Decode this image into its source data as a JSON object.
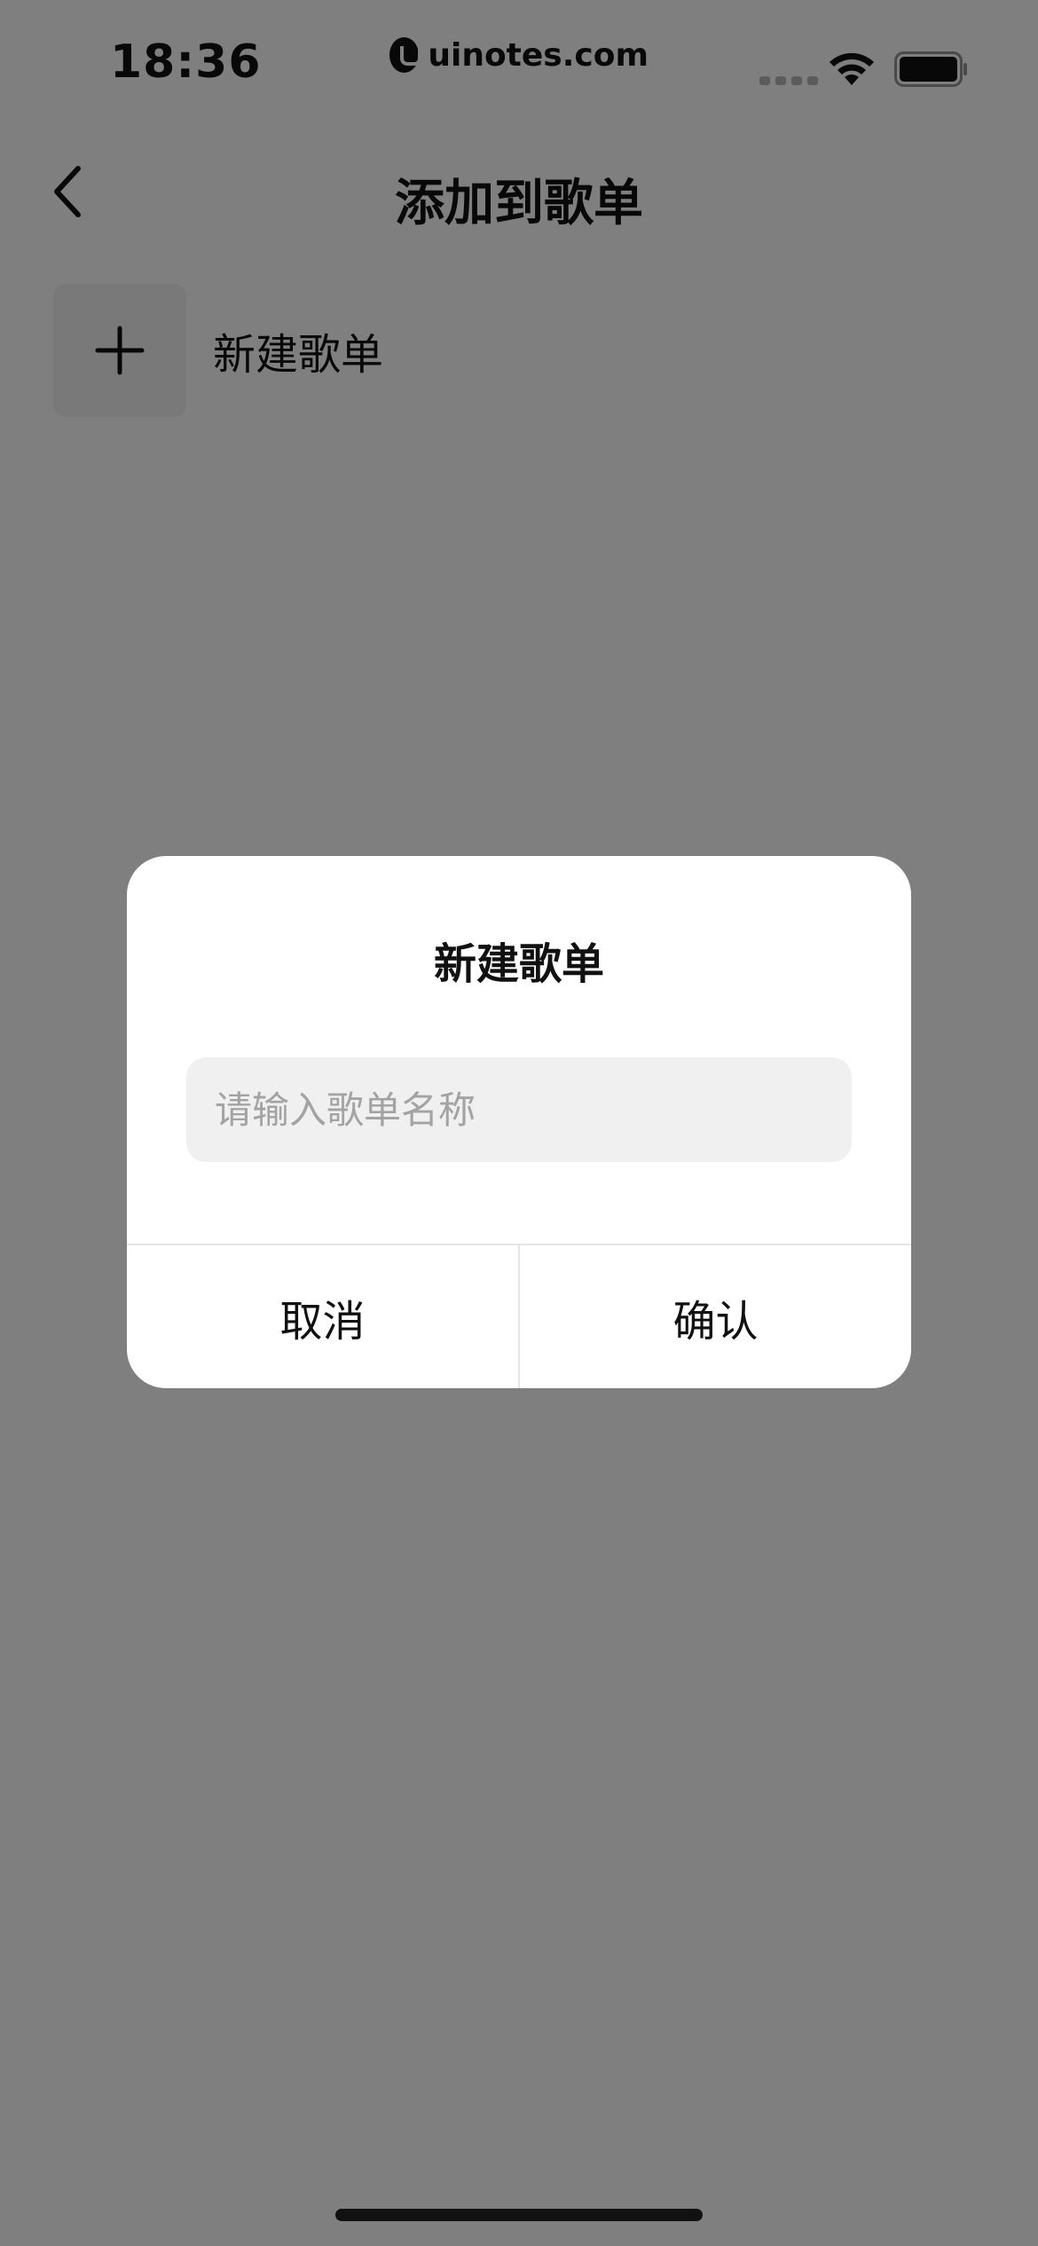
{
  "status_bar": {
    "time": "18:36",
    "watermark": "uinotes.com"
  },
  "nav": {
    "title": "添加到歌单",
    "back_icon": "chevron-left-icon"
  },
  "create_playlist": {
    "label": "新建歌单",
    "icon": "plus-icon"
  },
  "dialog": {
    "title": "新建歌单",
    "input_placeholder": "请输入歌单名称",
    "input_value": "",
    "cancel_label": "取消",
    "confirm_label": "确认"
  },
  "colors": {
    "overlay": "#000000",
    "dialog_bg": "#ffffff",
    "input_bg": "#f0f0f0",
    "placeholder": "#a3a3a3",
    "text": "#111111"
  }
}
